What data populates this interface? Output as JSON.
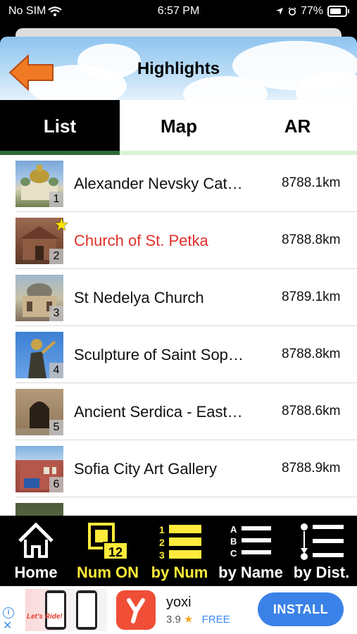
{
  "status": {
    "carrier": "No SIM",
    "time": "6:57 PM",
    "battery": "77%"
  },
  "header": {
    "title": "Highlights"
  },
  "tabs": [
    {
      "label": "List"
    },
    {
      "label": "Map"
    },
    {
      "label": "AR"
    }
  ],
  "list": [
    {
      "num": "1",
      "name": "Alexander Nevsky Cat…",
      "distance": "8788.1km",
      "favorite": false
    },
    {
      "num": "2",
      "name": "Church of St. Petka",
      "distance": "8788.8km",
      "favorite": true
    },
    {
      "num": "3",
      "name": "St Nedelya Church",
      "distance": "8789.1km",
      "favorite": false
    },
    {
      "num": "4",
      "name": "Sculpture of Saint Sop…",
      "distance": "8788.8km",
      "favorite": false
    },
    {
      "num": "5",
      "name": "Ancient Serdica - East…",
      "distance": "8788.6km",
      "favorite": false
    },
    {
      "num": "6",
      "name": "Sofia City Art Gallery",
      "distance": "8788.9km",
      "favorite": false
    }
  ],
  "toolbar": {
    "home": "Home",
    "num_on": "Num ON",
    "num_on_badge": "12",
    "by_num": "by Num",
    "by_num_digits": [
      "1",
      "2",
      "3"
    ],
    "by_name": "by Name",
    "by_name_letters": [
      "A",
      "B",
      "C"
    ],
    "by_dist": "by Dist."
  },
  "ad": {
    "app_name": "yoxi",
    "rating": "3.9",
    "price": "FREE",
    "install": "INSTALL",
    "creative_text": "Let's Ride!"
  },
  "colors": {
    "accent_yellow": "#ffeb3b",
    "favorite_red": "#e0302a",
    "install_blue": "#3b82e8",
    "back_arrow": "#f07a23"
  }
}
